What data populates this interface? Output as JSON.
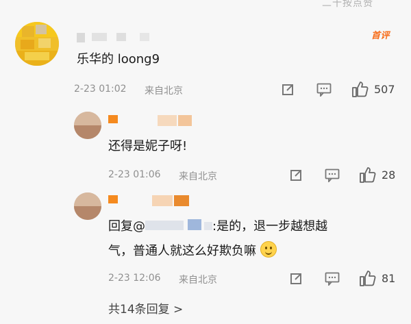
{
  "header_clip": "二十按点赞",
  "top_comment": {
    "badge": "首评",
    "text": "乐华的 loong9",
    "date": "2-23 01:02",
    "location": "来自北京",
    "likes": "507"
  },
  "replies": [
    {
      "text": "还得是妮子呀!",
      "date": "2-23 01:06",
      "location": "来自北京",
      "likes": "28"
    },
    {
      "reply_prefix": "回复",
      "mention_visible": "@",
      "text_line1": ":是的，退一步越想越",
      "text_line2": "气，普通人就这么好欺负嘛",
      "date": "2-23 12:06",
      "location": "来自北京",
      "likes": "81"
    }
  ],
  "more_replies": "共14条回复 >",
  "icons": [
    "share-icon",
    "comment-icon",
    "like-icon",
    "smile-emoji"
  ],
  "colors": {
    "badge": "#f76c19",
    "meta": "#8f8f8f",
    "background": "#f7f7f7"
  }
}
